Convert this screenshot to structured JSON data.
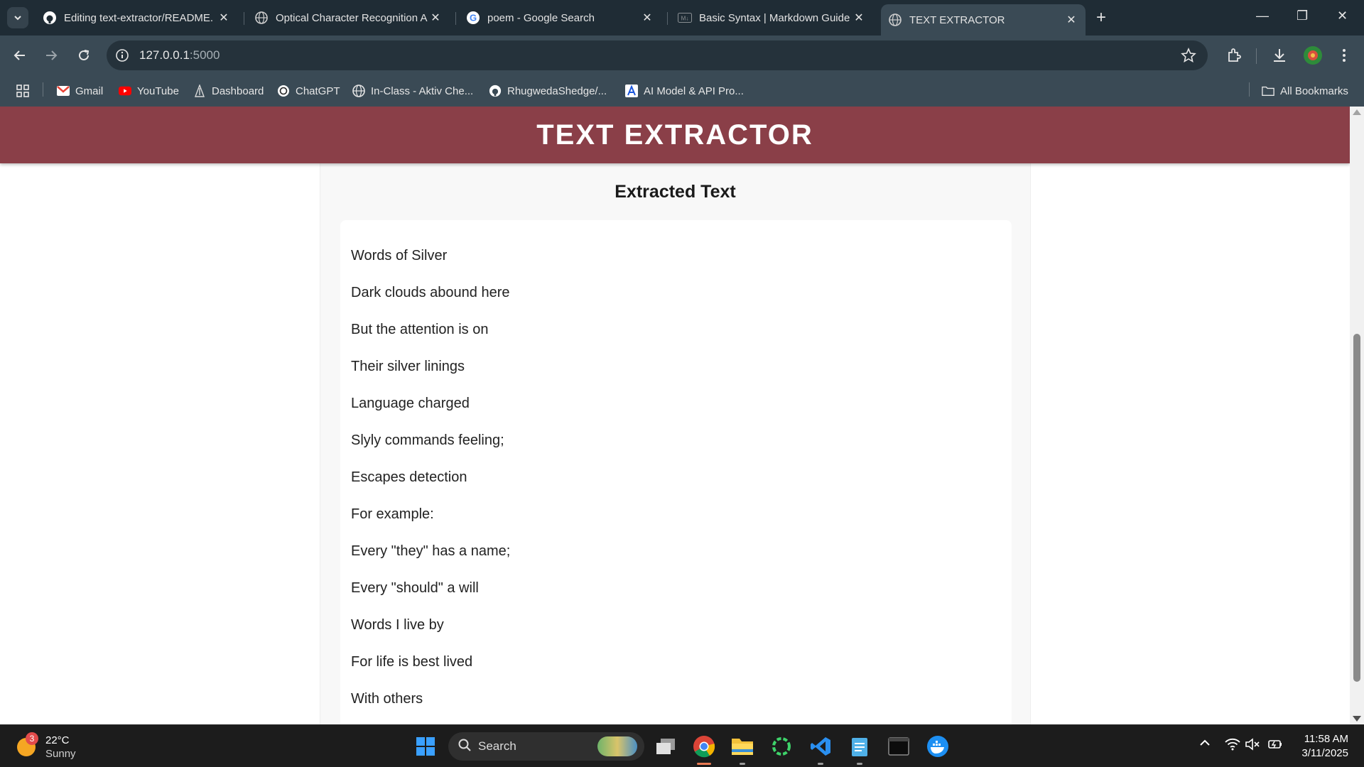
{
  "browser": {
    "tabs": [
      {
        "title": "Editing text-extractor/README.",
        "icon": "github-icon",
        "active": false
      },
      {
        "title": "Optical Character Recognition A",
        "icon": "globe-icon",
        "active": false
      },
      {
        "title": "poem - Google Search",
        "icon": "google-icon",
        "active": false
      },
      {
        "title": "Basic Syntax | Markdown Guide",
        "icon": "markdown-icon",
        "active": false
      },
      {
        "title": "TEXT EXTRACTOR",
        "icon": "globe-icon",
        "active": true
      }
    ],
    "url_host": "127.0.0.1",
    "url_port": ":5000",
    "bookmarks": [
      {
        "label": "Gmail",
        "icon": "gmail-icon"
      },
      {
        "label": "YouTube",
        "icon": "youtube-icon"
      },
      {
        "label": "Dashboard",
        "icon": "dashboard-icon"
      },
      {
        "label": "ChatGPT",
        "icon": "chatgpt-icon"
      },
      {
        "label": "In-Class - Aktiv Che...",
        "icon": "globe-icon"
      },
      {
        "label": "RhugwedaShedge/...",
        "icon": "github-icon"
      },
      {
        "label": "AI Model & API Pro...",
        "icon": "ai-icon"
      }
    ],
    "all_bookmarks": "All Bookmarks"
  },
  "page": {
    "header_title": "TEXT EXTRACTOR",
    "header_color": "#8a3f48",
    "card_title": "Extracted Text",
    "lines": [
      "Words of Silver",
      "Dark clouds abound here",
      "But the attention is on",
      "Their silver linings",
      "Language charged",
      "Slyly commands feeling;",
      "Escapes detection",
      "For example:",
      "Every \"they\" has a name;",
      "Every \"should\" a will",
      "Words I live by",
      "For life is best lived",
      "With others"
    ]
  },
  "taskbar": {
    "weather_temp": "22°C",
    "weather_desc": "Sunny",
    "weather_badge": "3",
    "search_label": "Search",
    "time": "11:58 AM",
    "date": "3/11/2025"
  }
}
